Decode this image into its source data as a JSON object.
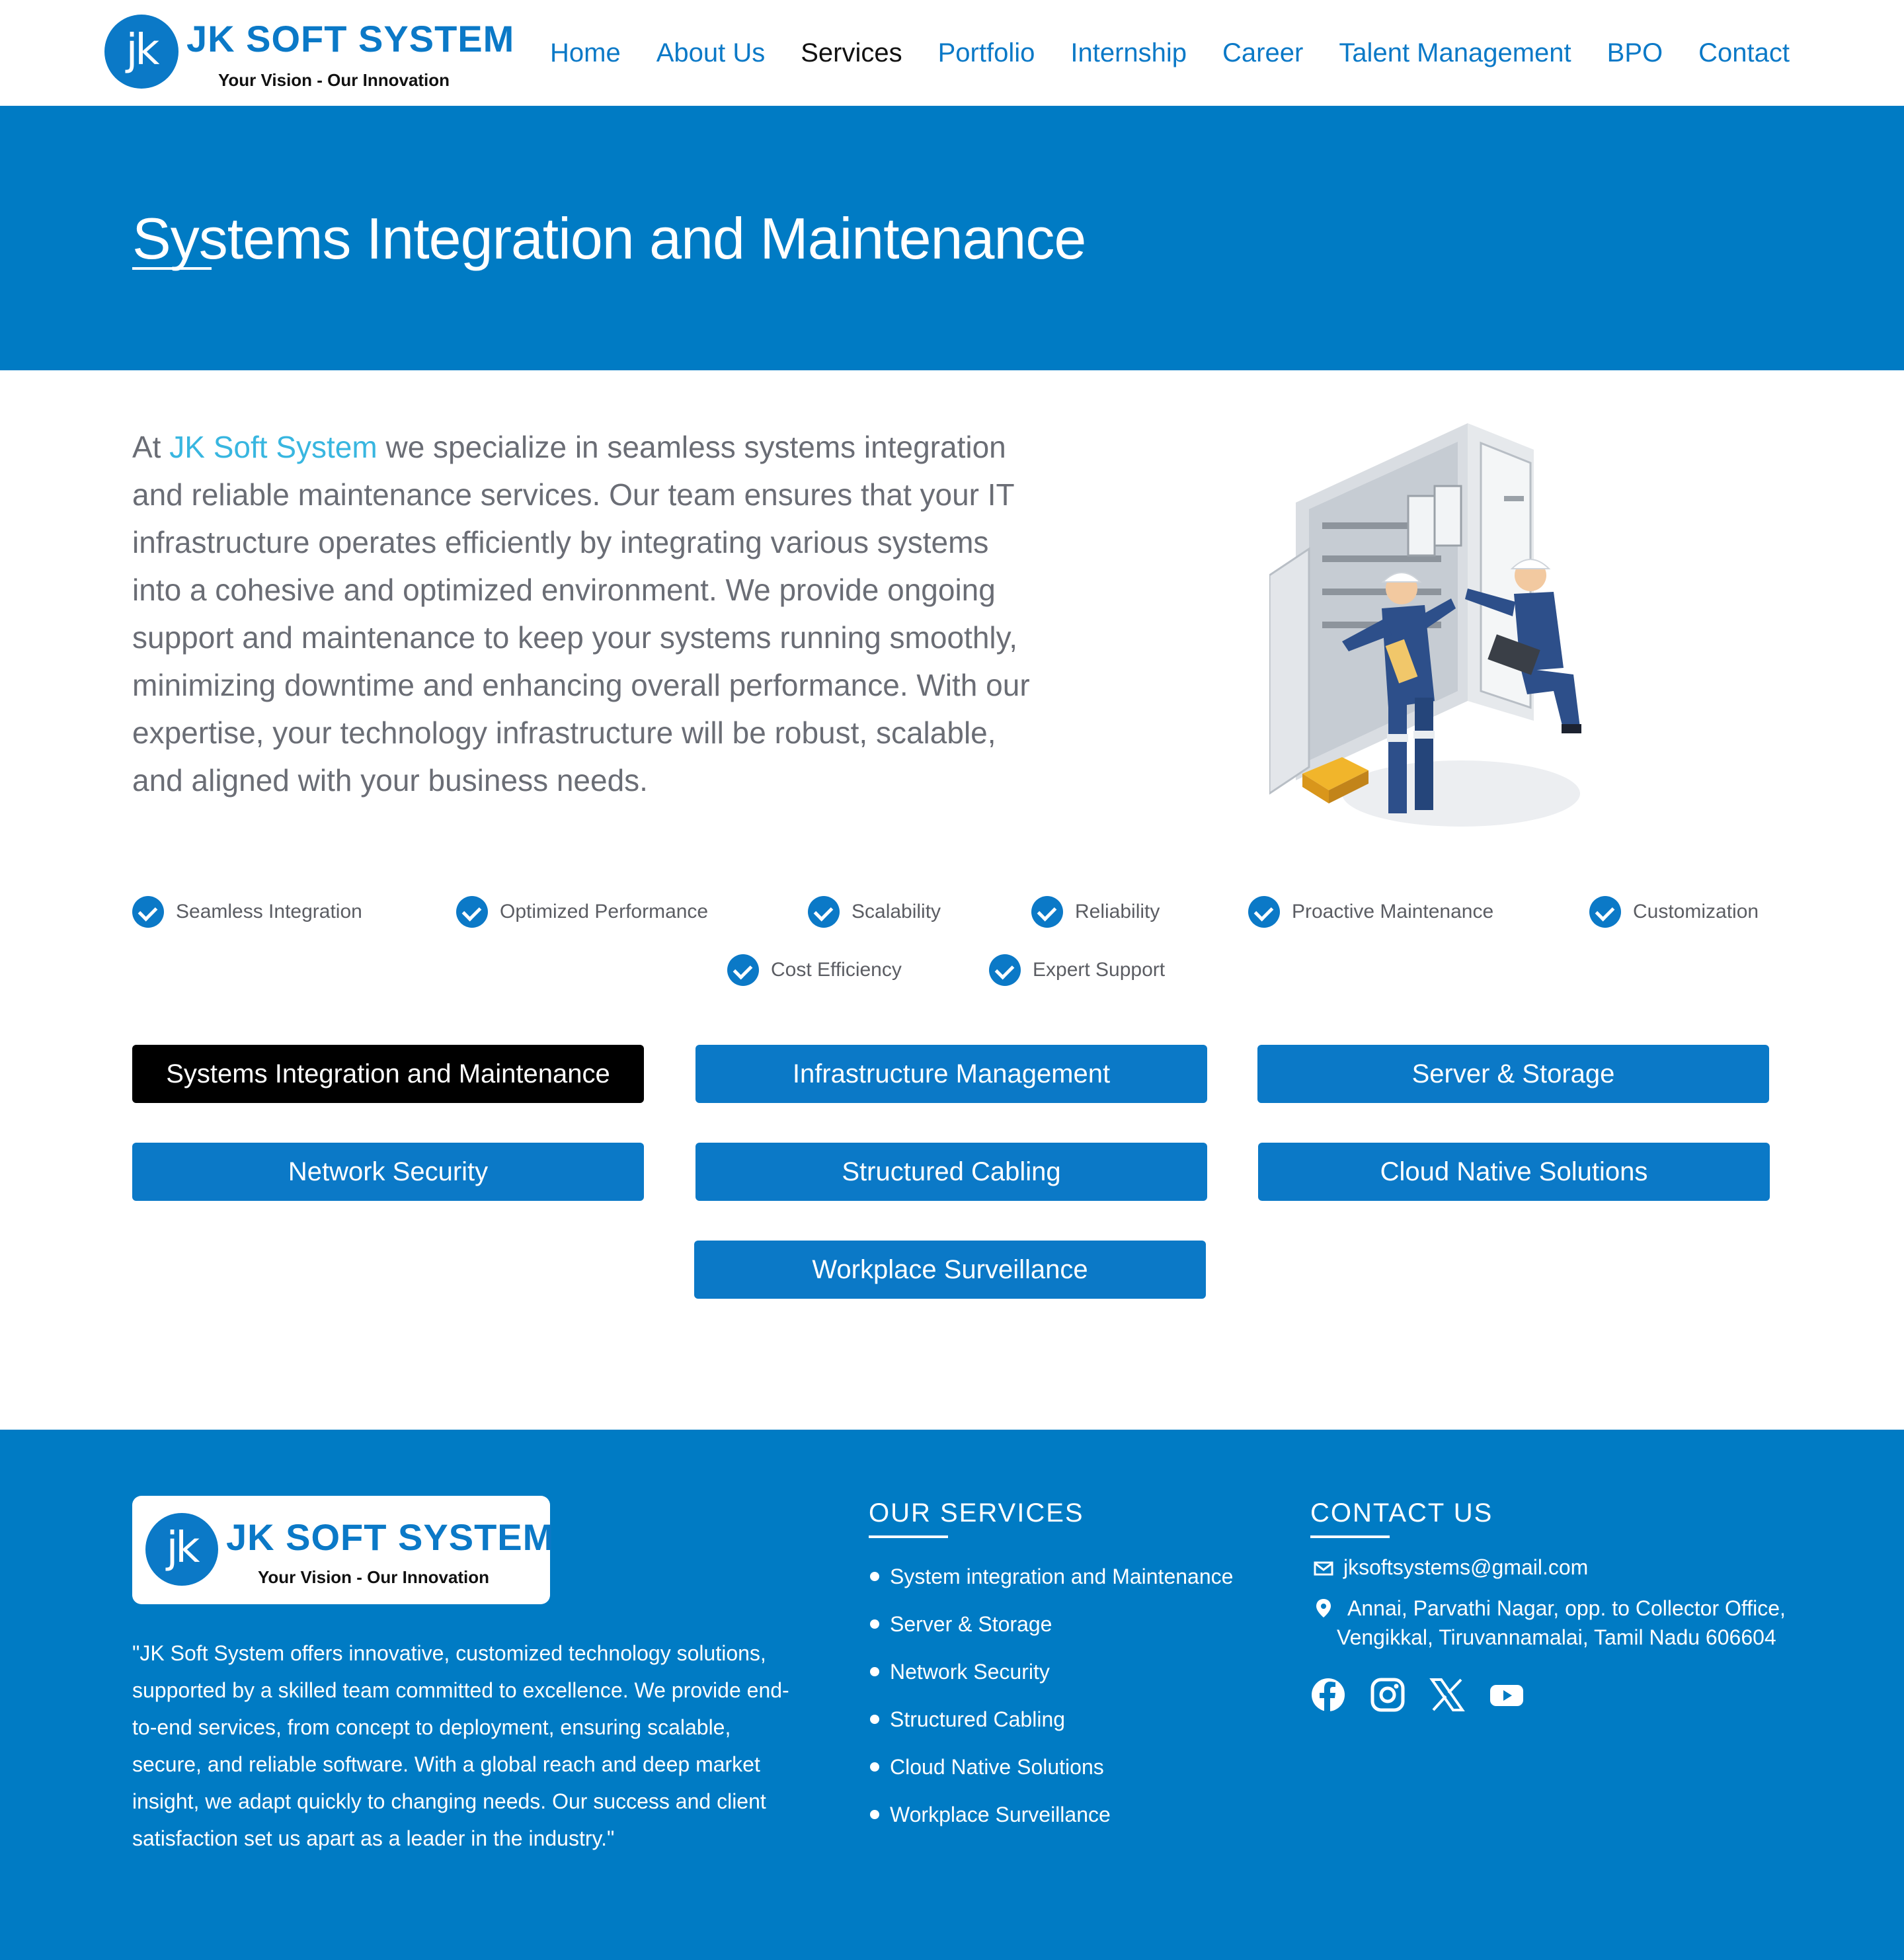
{
  "brand": {
    "logo_mark": "jk",
    "name": "JK SOFT SYSTEM",
    "tagline": "Your Vision - Our Innovation",
    "color": "#0b79c7"
  },
  "nav": {
    "items": [
      "Home",
      "About Us",
      "Services",
      "Portfolio",
      "Internship",
      "Career",
      "Talent Management",
      "BPO",
      "Contact"
    ],
    "active": "Services"
  },
  "hero": {
    "title": "Systems Integration and Maintenance",
    "background": "#007bc4"
  },
  "intro": {
    "prefix": "At ",
    "brand": "JK Soft System",
    "text": " we specialize in seamless systems integration and reliable maintenance services. Our team ensures that your IT infrastructure operates efficiently by integrating various systems into a cohesive and optimized environment. We provide ongoing support and maintenance to keep your systems running smoothly, minimizing downtime and enhancing overall performance. With our expertise, your technology infrastructure will be robust, scalable, and aligned with your business needs."
  },
  "illustration": {
    "icon": "technicians-electrical-cabinet-illustration"
  },
  "features": [
    "Seamless Integration",
    "Optimized Performance",
    "Scalability",
    "Reliability",
    "Proactive Maintenance",
    "Customization",
    "Cost Efficiency",
    "Expert Support"
  ],
  "services": {
    "buttons": [
      "Systems Integration and Maintenance",
      "Infrastructure Management",
      "Server & Storage",
      "Network Security",
      "Structured Cabling",
      "Cloud Native Solutions",
      "Workplace Surveillance"
    ],
    "active": "Systems Integration and Maintenance"
  },
  "footer": {
    "about": "\"JK Soft System offers innovative, customized technology solutions, supported by a skilled team committed to excellence. We provide end-to-end services, from concept to deployment, ensuring scalable, secure, and reliable software. With a global reach and deep market insight, we adapt quickly to changing needs. Our success and client satisfaction set us apart as a leader in the industry.\"",
    "services_heading": "OUR SERVICES",
    "services": [
      "System integration and Maintenance",
      "Server & Storage",
      "Network Security",
      "Structured Cabling",
      "Cloud Native Solutions",
      "Workplace Surveillance"
    ],
    "contact_heading": "CONTACT US",
    "email": "jksoftsystems@gmail.com",
    "address_line1": "Annai, Parvathi Nagar, opp. to Collector Office,",
    "address_line2": "Vengikkal, Tiruvannamalai, Tamil Nadu 606604",
    "socials": [
      "facebook-icon",
      "instagram-icon",
      "x-icon",
      "youtube-icon"
    ]
  }
}
